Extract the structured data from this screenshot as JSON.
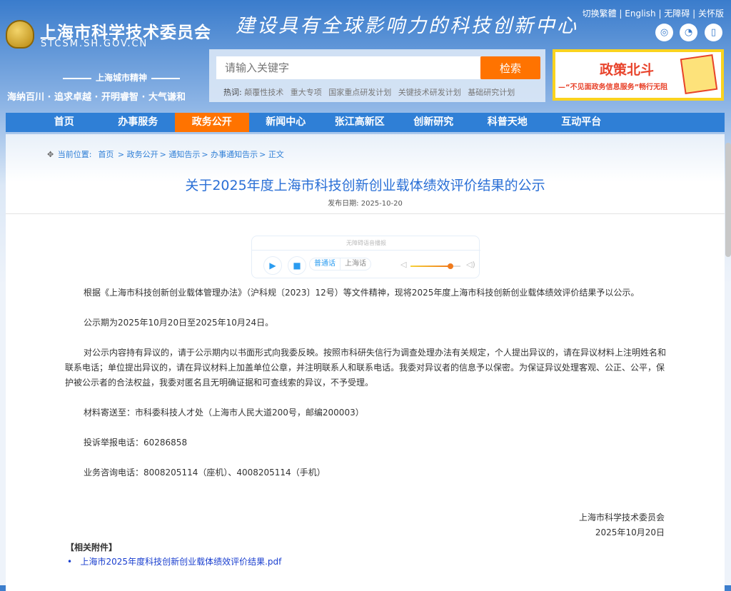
{
  "header": {
    "site_name": "上海市科学技术委员会",
    "site_domain": "STCSM.SH.GOV.CN",
    "slogan": "建设具有全球影响力的科技创新中心",
    "spirit_title": "上海城市精神",
    "spirit_text": "海纳百川 · 追求卓越 · 开明睿智 · 大气谦和",
    "top_links": [
      "切换繁體",
      "English",
      "无障碍",
      "关怀版"
    ],
    "social": [
      {
        "icon": "weibo-icon",
        "glyph": "◎"
      },
      {
        "icon": "wechat-icon",
        "glyph": "◔"
      },
      {
        "icon": "mobile-icon",
        "glyph": "▯"
      }
    ]
  },
  "search": {
    "placeholder": "请输入关键字",
    "button": "检索",
    "hot_label": "热词:",
    "hot_words": [
      "颠覆性技术",
      "重大专项",
      "国家重点研发计划",
      "关键技术研发计划",
      "基础研究计划"
    ]
  },
  "banner": {
    "title": "政策北斗",
    "subtitle": "—“不见面政务信息服务”畅行无阻"
  },
  "nav": [
    "首页",
    "办事服务",
    "政务公开",
    "新闻中心",
    "张江高新区",
    "创新研究",
    "科普天地",
    "互动平台"
  ],
  "breadcrumb": {
    "label": "当前位置:",
    "items": [
      "首页",
      "政务公开",
      "通知告示",
      "办事通知告示",
      "正文"
    ]
  },
  "article": {
    "title": "关于2025年度上海市科技创新创业载体绩效评价结果的公示",
    "date_label": "发布日期:",
    "date": "2025-10-20",
    "paragraphs": [
      "根据《上海市科技创新创业载体管理办法》（沪科规〔2023〕12号）等文件精神，现将2025年度上海市科技创新创业载体绩效评价结果予以公示。",
      "公示期为2025年10月20日至2025年10月24日。",
      "对公示内容持有异议的，请于公示期内以书面形式向我委反映。按照市科研失信行为调查处理办法有关规定，个人提出异议的，请在异议材料上注明姓名和联系电话；单位提出异议的，请在异议材料上加盖单位公章，并注明联系人和联系电话。我委对异议者的信息予以保密。为保证异议处理客观、公正、公平，保护被公示者的合法权益，我委对匿名且无明确证据和可查线索的异议，不予受理。",
      "材料寄送至：市科委科技人才处（上海市人民大道200号，邮编200003）",
      "投诉举报电话：60286858",
      "业务咨询电话：8008205114（座机）、4008205114（手机）"
    ],
    "signature": "上海市科学技术委员会",
    "sign_date": "2025年10月20日",
    "attachments_title": "【相关附件】",
    "attachment": "上海市2025年度科技创新创业载体绩效评价结果.pdf"
  },
  "audio": {
    "title": "无障碍语音播报",
    "lang": [
      "普通话",
      "上海话"
    ],
    "volume": 0.8,
    "active_color": "#2b9cf0"
  }
}
